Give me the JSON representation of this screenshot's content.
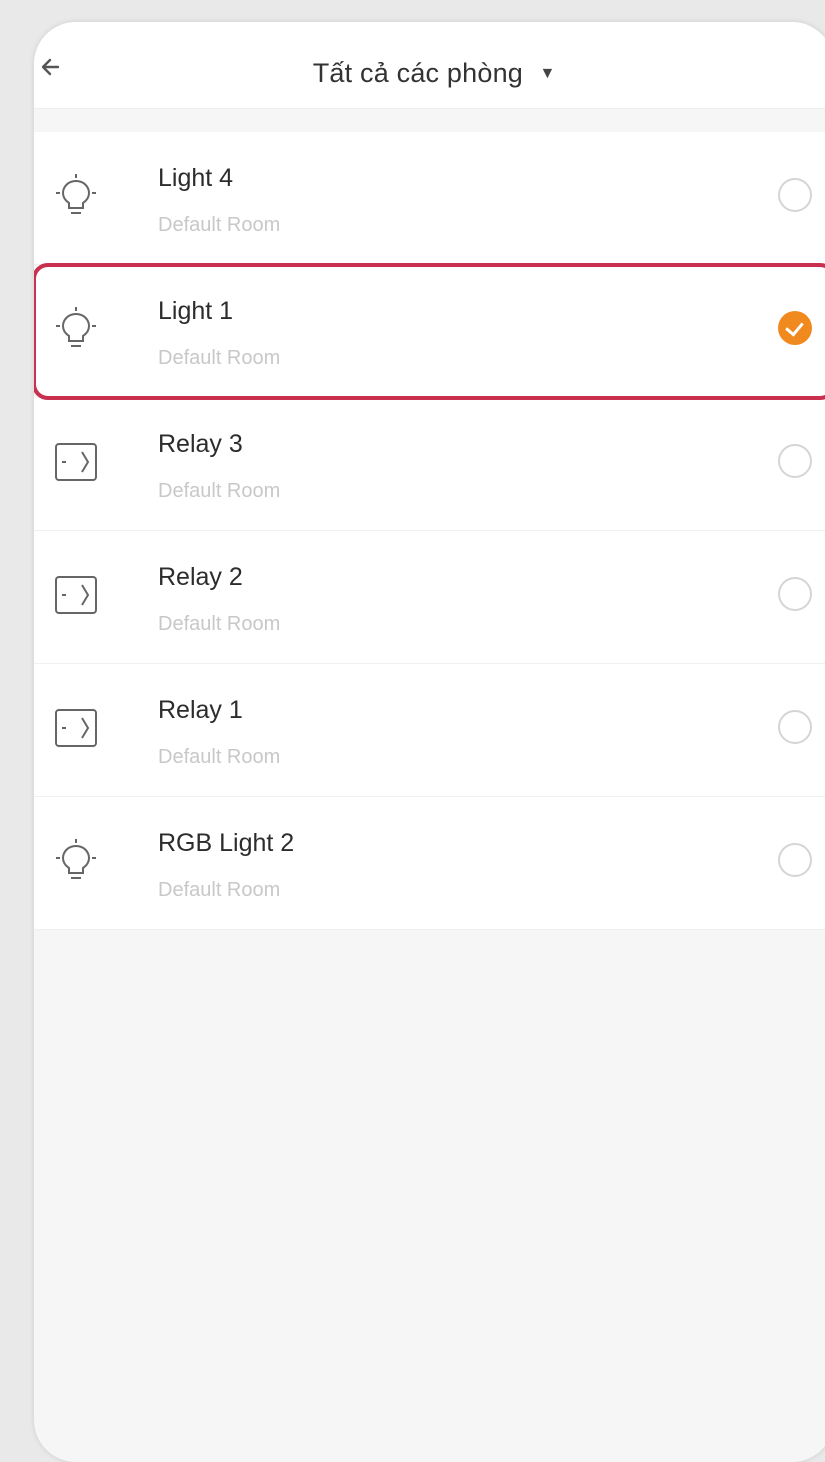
{
  "header": {
    "title": "Tất cả các phòng",
    "back_icon": "arrow-left-icon",
    "dropdown_icon": "caret-down-icon"
  },
  "accent_color": "#f08a1f",
  "highlight_color": "#c92f4f",
  "devices": [
    {
      "name": "Light 4",
      "room": "Default Room",
      "icon": "bulb-icon",
      "selected": false
    },
    {
      "name": "Light 1",
      "room": "Default Room",
      "icon": "bulb-icon",
      "selected": true
    },
    {
      "name": "Relay 3",
      "room": "Default Room",
      "icon": "relay-icon",
      "selected": false
    },
    {
      "name": "Relay 2",
      "room": "Default Room",
      "icon": "relay-icon",
      "selected": false
    },
    {
      "name": "Relay 1",
      "room": "Default Room",
      "icon": "relay-icon",
      "selected": false
    },
    {
      "name": "RGB Light 2",
      "room": "Default Room",
      "icon": "bulb-icon",
      "selected": false
    }
  ]
}
